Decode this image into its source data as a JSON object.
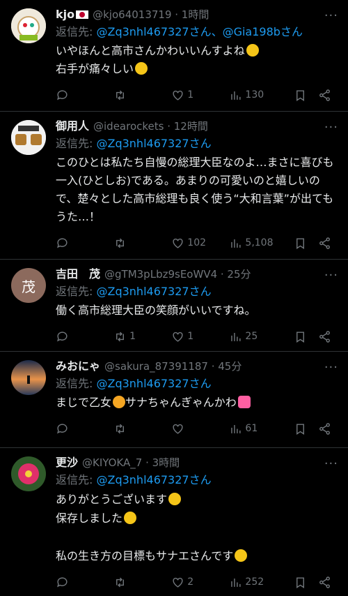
{
  "tweets": [
    {
      "name": "kjo",
      "handle": "@kjo64013719 · 1時間",
      "reply_prefix": "返信先: ",
      "reply_to": "@Zq3nhl467327さん、@Gia198bさん",
      "text": "いやほんと高市さんかわいいんすよね",
      "text2": "右手が痛々しい",
      "likes": "1",
      "views": "130",
      "replies": "",
      "retweets": ""
    },
    {
      "name": "御用人",
      "handle": "@idearockets · 12時間",
      "reply_prefix": "返信先: ",
      "reply_to": "@Zq3nhl467327さん",
      "text": "このひとは私たち自慢の総理大臣なのよ…まさに喜びも一入(ひとしお)である。あまりの可愛いのと嬉しいので、楚々とした高市総理も良く使う“大和言葉”が出てもうた…！",
      "likes": "102",
      "views": "5,108",
      "replies": "",
      "retweets": ""
    },
    {
      "name": "吉田　茂",
      "avatar_char": "茂",
      "handle": "@gTM3pLbz9sEoWV4 · 25分",
      "reply_prefix": "返信先: ",
      "reply_to": "@Zq3nhl467327さん",
      "text": "働く高市総理大臣の笑顔がいいですね。",
      "likes": "1",
      "views": "25",
      "replies": "",
      "retweets": "1"
    },
    {
      "name": "みおにゃ",
      "handle": "@sakura_87391187 · 45分",
      "reply_prefix": "返信先: ",
      "reply_to": "@Zq3nhl467327さん",
      "text": "まじで乙女",
      "text2": "サナちゃんぎゃんかわ",
      "likes": "",
      "views": "61",
      "replies": "",
      "retweets": ""
    },
    {
      "name": "更沙",
      "handle": "@KIYOKA_7 · 3時間",
      "reply_prefix": "返信先: ",
      "reply_to": "@Zq3nhl467327さん",
      "line1": "ありがとうございます",
      "line2": "保存しました",
      "line3": "私の生き方の目標もサナエさんです",
      "likes": "2",
      "views": "252",
      "replies": "",
      "retweets": ""
    }
  ],
  "more_icon": "···",
  "colors": {
    "accent": "#1d9bf0",
    "muted": "#71767b",
    "text": "#e7e9ea",
    "border": "#2f3336"
  }
}
